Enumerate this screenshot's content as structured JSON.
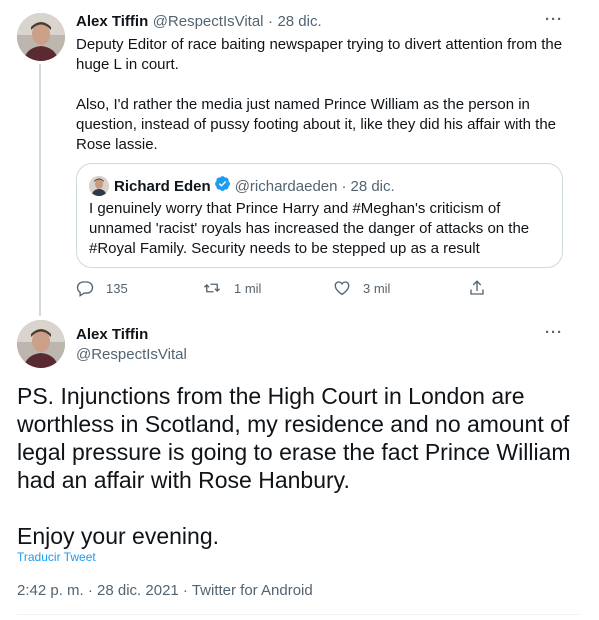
{
  "tweet1": {
    "author_name": "Alex Tiffin",
    "author_handle": "@RespectIsVital",
    "separator": "·",
    "date": "28 dic.",
    "paragraphs": [
      "Deputy Editor of race baiting newspaper trying to divert attention from the huge L in court.",
      "Also, I'd rather the media just named Prince William as the person in question, instead of pussy footing about it, like they did his affair with the Rose lassie."
    ],
    "quoted": {
      "author_name": "Richard Eden",
      "author_handle": "@richardaeden",
      "separator": "·",
      "date": "28 dic.",
      "text": "I genuinely worry that Prince Harry and #Meghan's criticism of unnamed 'racist' royals has increased the danger of attacks on the #Royal Family. Security needs to be stepped up as a result"
    },
    "actions": {
      "replies": "135",
      "retweets": "1 mil",
      "likes": "3 mil"
    }
  },
  "tweet2": {
    "author_name": "Alex Tiffin",
    "author_handle": "@RespectIsVital",
    "paragraphs": [
      "PS. Injunctions from the High Court in London are worthless in Scotland, my residence and no amount of legal pressure is going to erase the fact Prince William had an affair with Rose Hanbury.",
      "Enjoy your evening."
    ],
    "translate_link": "Traducir Tweet",
    "meta": "2:42 p. m. · 28 dic. 2021 · Twitter for Android"
  },
  "more_menu": "···",
  "colors": {
    "text": "#0f1419",
    "muted": "#536471",
    "link": "#1d9bf0",
    "border": "#cfd9de"
  }
}
